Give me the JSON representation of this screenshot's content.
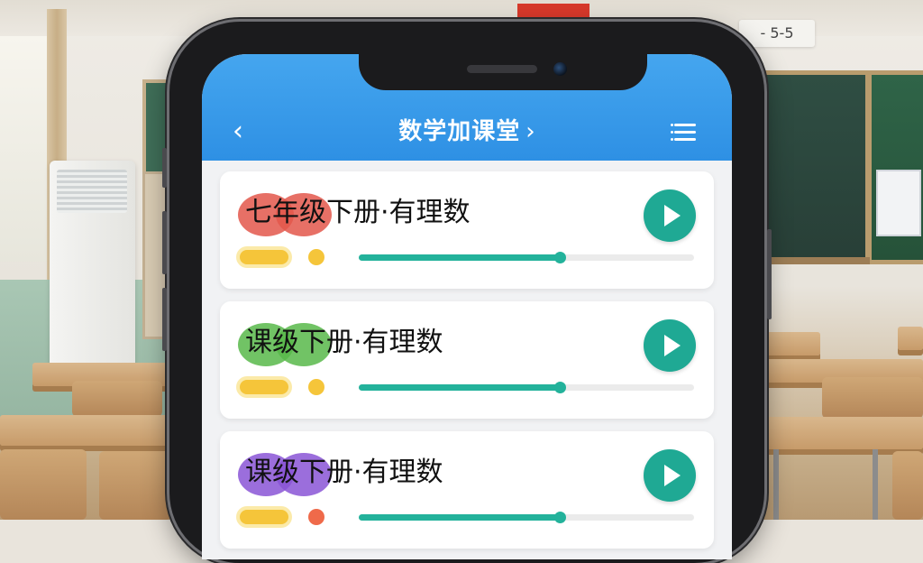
{
  "header": {
    "title": "数学加课堂",
    "back_icon": "‹",
    "chevron_icon": "›",
    "menu_icon": "list-icon"
  },
  "colors": {
    "header_blue": "#3a9beb",
    "play_teal": "#1fa994",
    "progress_teal": "#23b29b",
    "badge_yellow": "#f5c53a"
  },
  "lessons": [
    {
      "title": "七年级下册·有理数",
      "badge_color": "#e3574b",
      "dot_color": "#f5c53a",
      "progress": 0.6
    },
    {
      "title": "课级下册·有理数",
      "badge_color": "#58b84a",
      "dot_color": "#f5c53a",
      "progress": 0.6
    },
    {
      "title": "课级下册·有理数",
      "badge_color": "#8a55d6",
      "dot_color": "#ef6a4a",
      "progress": 0.6
    }
  ],
  "background": {
    "sign_text": "- 5-5"
  }
}
